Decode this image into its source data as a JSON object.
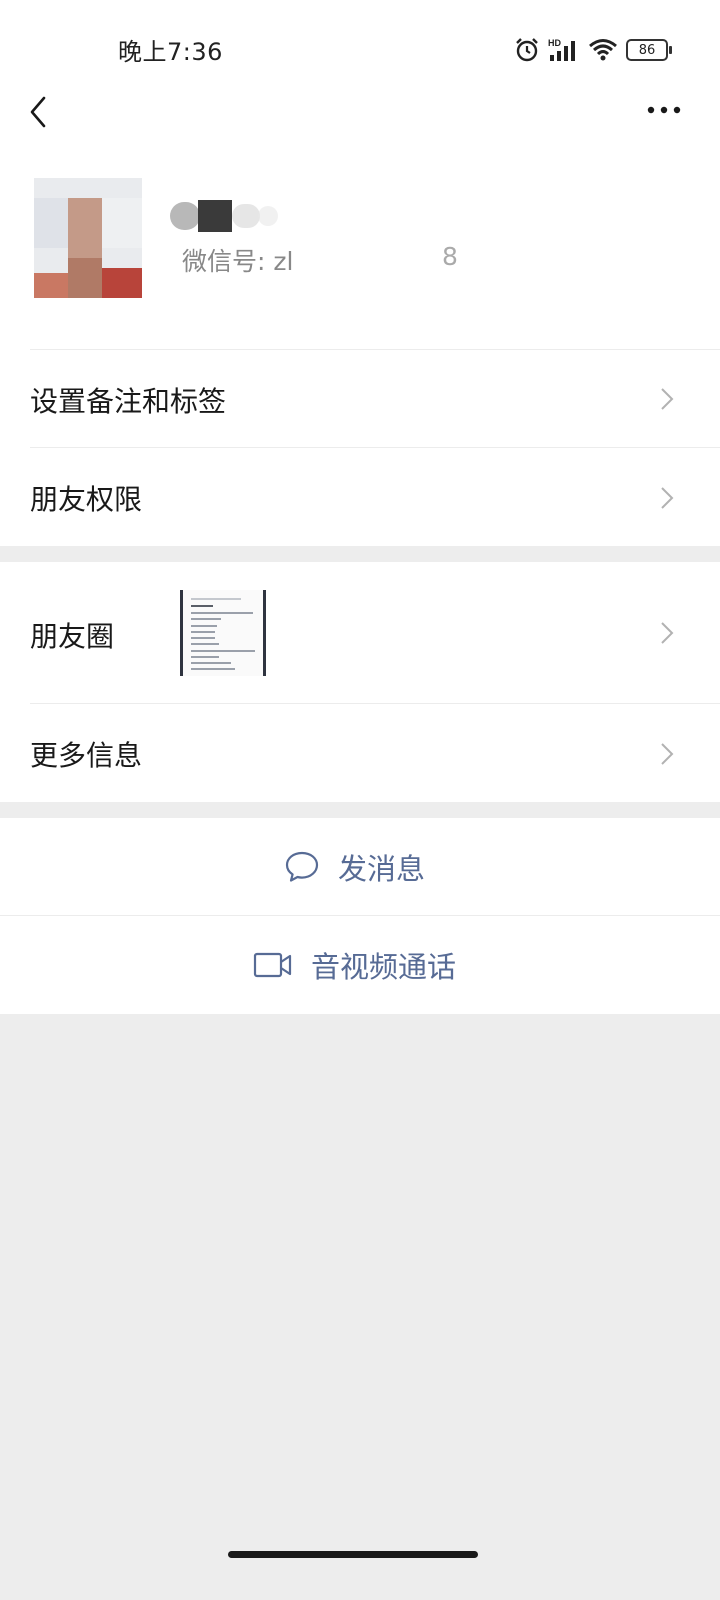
{
  "status_bar": {
    "time": "晚上7:36",
    "battery": "86",
    "network_label": "HD",
    "icons": [
      "alarm-icon",
      "signal-icon",
      "wifi-icon",
      "battery-icon"
    ]
  },
  "nav": {
    "back_icon": "chevron-left-icon",
    "more_icon": "ellipsis-icon"
  },
  "profile": {
    "wechat_id_label": "微信号: zl",
    "wechat_id_tail": "8"
  },
  "menu": {
    "remark_tags": "设置备注和标签",
    "friend_permissions": "朋友权限",
    "moments": "朋友圈",
    "more_info": "更多信息"
  },
  "actions": {
    "send_message": "发消息",
    "av_call": "音视频通话"
  },
  "colors": {
    "link_blue": "#576b95",
    "background": "#ededed",
    "card": "#ffffff"
  }
}
